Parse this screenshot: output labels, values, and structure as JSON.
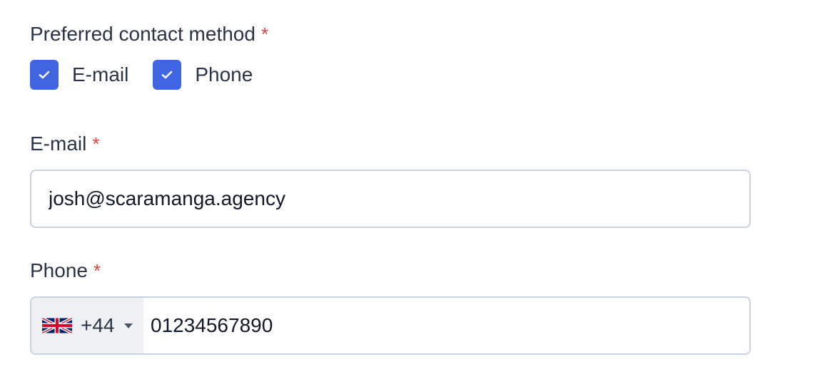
{
  "contact_method": {
    "label": "Preferred contact method",
    "required_marker": "*",
    "options": [
      {
        "label": "E-mail",
        "checked": true
      },
      {
        "label": "Phone",
        "checked": true
      }
    ]
  },
  "email": {
    "label": "E-mail",
    "required_marker": "*",
    "value": "josh@scaramanga.agency"
  },
  "phone": {
    "label": "Phone",
    "required_marker": "*",
    "country_flag": "uk-flag-icon",
    "dial_code": "+44",
    "value": "01234567890"
  },
  "colors": {
    "accent": "#3f66e0",
    "required": "#e0413e",
    "border": "#c9d2de",
    "prefix_bg": "#eef0f3"
  }
}
